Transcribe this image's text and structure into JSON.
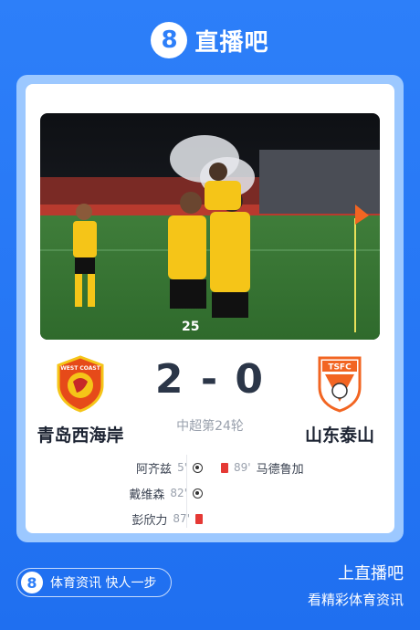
{
  "brand": {
    "logo_glyph": "8",
    "name": "直播吧"
  },
  "match": {
    "home_team": "青岛西海岸",
    "away_team": "山东泰山",
    "score": "2 - 0",
    "round": "中超第24轮",
    "home_crest_text": "WEST COAST",
    "away_crest_text": "TSFC"
  },
  "events": {
    "home": [
      {
        "player": "阿齐兹",
        "minute": "5'",
        "type": "goal"
      },
      {
        "player": "戴维森",
        "minute": "82'",
        "type": "goal"
      },
      {
        "player": "彭欣力",
        "minute": "87'",
        "type": "red-card"
      }
    ],
    "away": [
      {
        "player": "马德鲁加",
        "minute": "89'",
        "type": "red-card"
      }
    ]
  },
  "footer": {
    "pill_logo": "8",
    "pill_text": "体育资讯 快人一步",
    "line1": "上直播吧",
    "line2": "看精彩体育资讯"
  },
  "colors": {
    "background": "#2d7ff9",
    "card_border": "#9cc8ff",
    "score_text": "#2b3648",
    "red_card": "#e53935",
    "home_yellow": "#f5c518",
    "away_orange": "#f26522"
  }
}
